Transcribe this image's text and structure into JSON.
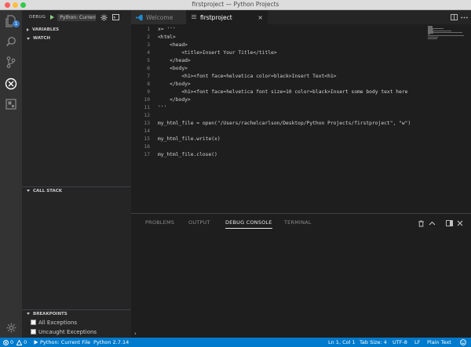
{
  "window": {
    "title": "firstproject — Python Projects"
  },
  "activity_bar": {
    "icons": [
      "files-icon",
      "search-icon",
      "source-control-icon",
      "debug-icon",
      "extensions-icon",
      "settings-gear-icon"
    ],
    "explorer_badge": "1"
  },
  "debug_toolbar": {
    "label": "DEBUG",
    "configuration": "Python: Current File"
  },
  "sidebar": {
    "variables_title": "VARIABLES",
    "watch_title": "WATCH",
    "call_stack_title": "CALL STACK",
    "breakpoints_title": "BREAKPOINTS",
    "breakpoints": [
      {
        "label": "All Exceptions",
        "checked": false
      },
      {
        "label": "Uncaught Exceptions",
        "checked": false
      }
    ]
  },
  "tabs": [
    {
      "label": "Welcome",
      "active": false
    },
    {
      "label": "firstproject",
      "active": true,
      "close": "×"
    }
  ],
  "editor": {
    "lines": [
      {
        "num": "1",
        "text": "x= '''"
      },
      {
        "num": "2",
        "text": "<html>"
      },
      {
        "num": "3",
        "text": "    <head>"
      },
      {
        "num": "4",
        "text": "        <title>Insert Your Title</title>"
      },
      {
        "num": "5",
        "text": "    </head>"
      },
      {
        "num": "6",
        "text": "    <body>"
      },
      {
        "num": "7",
        "text": "        <h1><font face=helvetica color=black>Insert Text<h1>"
      },
      {
        "num": "8",
        "text": "    </body>"
      },
      {
        "num": "9",
        "text": "        <h1><font face=helvetica font size=10 color=black>Insert some body text here"
      },
      {
        "num": "10",
        "text": "    </body>"
      },
      {
        "num": "11",
        "text": "'''"
      },
      {
        "num": "12",
        "text": ""
      },
      {
        "num": "13",
        "text": "my_html_file = open(\"/Users/rachelcarlson/Desktop/Python Projects/firstproject\", \"w\")"
      },
      {
        "num": "14",
        "text": ""
      },
      {
        "num": "15",
        "text": "my_html_file.write(x)"
      },
      {
        "num": "16",
        "text": ""
      },
      {
        "num": "17",
        "text": "my_html_file.close()"
      }
    ]
  },
  "panel": {
    "tabs": [
      "PROBLEMS",
      "OUTPUT",
      "DEBUG CONSOLE",
      "TERMINAL"
    ],
    "active_tab": "DEBUG CONSOLE",
    "prompt": "›"
  },
  "status_bar": {
    "errors": "0",
    "warnings": "0",
    "debug_config": "Python: Current File",
    "interpreter": "Python 2.7.14",
    "position": "Ln 1, Col 1",
    "tab_size": "Tab Size: 4",
    "encoding": "UTF-8",
    "eol": "LF",
    "language": "Plain Text"
  },
  "colors": {
    "status_bar": "#007acc",
    "editor_bg": "#1e1e1e",
    "sidebar_bg": "#252526",
    "activity_bar_bg": "#333333"
  }
}
